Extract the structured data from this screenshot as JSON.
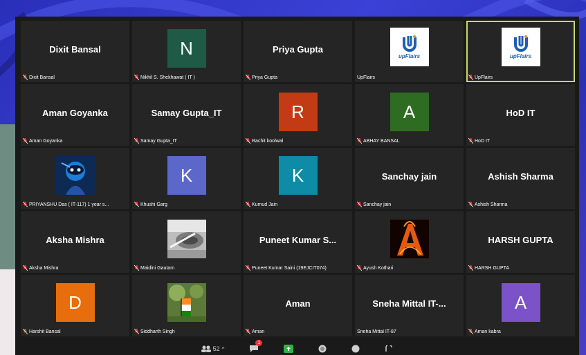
{
  "colors": {
    "avatar_n": "#1f5a46",
    "avatar_r": "#c23b14",
    "avatar_a_green": "#2e6c22",
    "avatar_k_blue": "#5b68c9",
    "avatar_k_teal": "#0e8ba6",
    "avatar_d": "#e86d0c",
    "avatar_a_purple": "#7b52c7",
    "active_border": "#c8d86a",
    "mute_red": "#e53935"
  },
  "tiles": [
    {
      "center": "Dixit Bansal",
      "label": "Dixit Bansal"
    },
    {
      "letter": "N",
      "label": "Nikhil S. Shekhawat ( IT )"
    },
    {
      "center": "Priya Gupta",
      "label": "Priya Gupta"
    },
    {
      "logo": "upFlairs",
      "label": "UpFlairs"
    },
    {
      "logo": "upFlairs",
      "label": "UpFlairs"
    },
    {
      "center": "Aman Goyanka",
      "label": "Aman Goyanka"
    },
    {
      "center": "Samay Gupta_IT",
      "label": "Samay Gupta_IT"
    },
    {
      "letter": "R",
      "label": "Rachit koolwal"
    },
    {
      "letter": "A",
      "label": "ABHAY BANSAL"
    },
    {
      "center": "HoD IT",
      "label": "HoD IT"
    },
    {
      "label": "PRIYANSHU Das ( IT-117) 1 year s..."
    },
    {
      "letter": "K",
      "label": "Khushi Garg"
    },
    {
      "letter": "K",
      "label": "Kumud Jain"
    },
    {
      "center": "Sanchay jain",
      "label": "Sanchay jain"
    },
    {
      "center": "Ashish Sharma",
      "label": "Ashish Sharma"
    },
    {
      "center": "Aksha Mishra",
      "label": "Aksha Mishra"
    },
    {
      "label": "Maidini Gautam"
    },
    {
      "center": "Puneet Kumar S...",
      "label": "Puneet Kumar Saini (19EJCIT074)"
    },
    {
      "label": "Ayush Kothari"
    },
    {
      "center": "HARSH GUPTA",
      "label": "HARSH GUPTA"
    },
    {
      "letter": "D",
      "label": "Harshit Bansal"
    },
    {
      "label": "Siddharth Singh"
    },
    {
      "center": "Aman",
      "label": "Aman"
    },
    {
      "center": "Sneha Mittal IT-...",
      "label": "Sneha Mittal IT-87"
    },
    {
      "letter": "A",
      "label": "Aman kabra"
    }
  ],
  "toolbar": {
    "participants_count": "52",
    "chat_badge": "1"
  }
}
